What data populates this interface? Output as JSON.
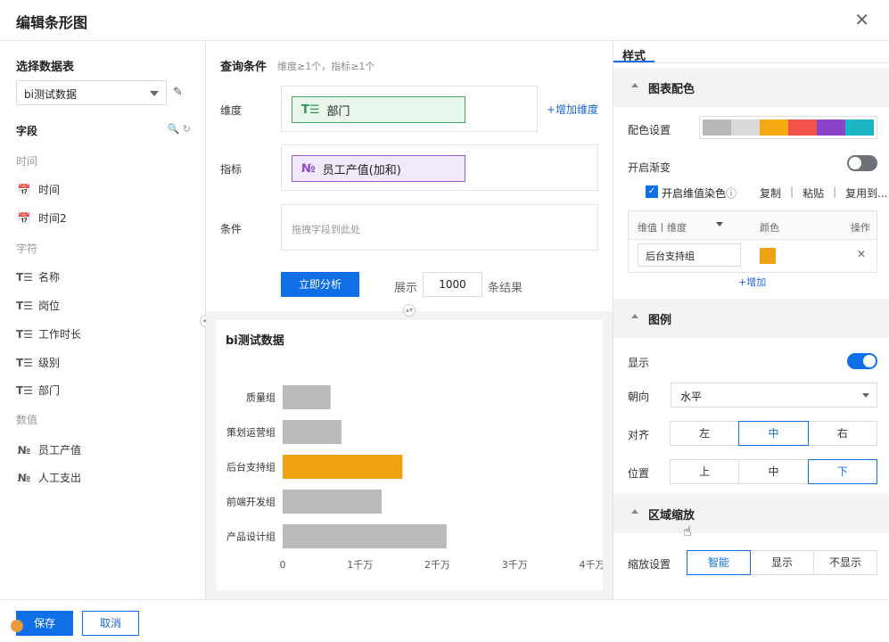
{
  "dialog": {
    "title": "编辑条形图",
    "close": "✕"
  },
  "left": {
    "section_title": "选择数据表",
    "table_select": "bi测试数据",
    "fields_label": "字段",
    "fields_icons": "🔍 ↻",
    "groups": [
      {
        "label": "时间",
        "fields": [
          {
            "icon": "📅",
            "name": "时间"
          },
          {
            "icon": "📅",
            "name": "时间2"
          }
        ]
      },
      {
        "label": "字符",
        "fields": [
          {
            "icon": "T☰",
            "name": "名称"
          },
          {
            "icon": "T☰",
            "name": "岗位"
          },
          {
            "icon": "T☰",
            "name": "工作时长"
          },
          {
            "icon": "T☰",
            "name": "级别"
          },
          {
            "icon": "T☰",
            "name": "部门"
          }
        ]
      },
      {
        "label": "数值",
        "fields": [
          {
            "icon": "№",
            "name": "员工产值"
          },
          {
            "icon": "№",
            "name": "人工支出"
          }
        ]
      }
    ]
  },
  "query": {
    "title": "查询条件",
    "hint": "维度≥1个，指标≥1个",
    "dimension_label": "维度",
    "dimension_chip": {
      "icon": "T☰",
      "text": "部门"
    },
    "add_dimension": "+增加维度",
    "metric_label": "指标",
    "metric_chip": {
      "icon": "№",
      "text": "员工产值(加和)"
    },
    "condition_label": "条件",
    "condition_placeholder": "拖拽字段到此处",
    "analyze_button": "立即分析",
    "show_label": "展示",
    "show_value": "1000",
    "show_suffix": "条结果"
  },
  "chart_data": {
    "type": "bar",
    "orientation": "horizontal",
    "title": "bi测试数据",
    "categories": [
      "质量组",
      "策划运营组",
      "后台支持组",
      "前端开发组",
      "产品设计组"
    ],
    "values": [
      6200000,
      7600000,
      15500000,
      12800000,
      21200000
    ],
    "highlight": "后台支持组",
    "bar_color": "#bbbbbb",
    "highlight_color": "#efa211",
    "xlim": [
      0,
      40000000
    ],
    "xticks": [
      "0",
      "1千万",
      "2千万",
      "3千万",
      "4千万"
    ],
    "grid": false
  },
  "style": {
    "tab": "样式",
    "sections": {
      "color": "图表配色",
      "legend": "图例",
      "zoom": "区域缩放"
    },
    "color_setting_label": "配色设置",
    "palette": [
      "#b8b8b8",
      "#d9d9d9",
      "#f5a915",
      "#f2544b",
      "#8c43c7",
      "#1bb6c4"
    ],
    "gradient_label": "开启渐变",
    "gradient_on": false,
    "dim_color_label": "开启维值染色",
    "dim_color_checked": true,
    "copy": "复制",
    "paste": "粘贴",
    "copy_to": "复用到...",
    "map_headers": {
      "dim": "维值丨维度",
      "color": "颜色",
      "op": "操作"
    },
    "map_row_value": "后台支持组",
    "map_row_color": "#efa211",
    "add_label": "+增加",
    "legend_show_label": "显示",
    "legend_show_on": true,
    "legend_orient_label": "朝向",
    "legend_orient_value": "水平",
    "legend_align_label": "对齐",
    "legend_align_options": [
      "左",
      "中",
      "右"
    ],
    "legend_align_selected": "中",
    "legend_pos_label": "位置",
    "legend_pos_options": [
      "上",
      "中",
      "下"
    ],
    "legend_pos_selected": "下",
    "zoom_label": "缩放设置",
    "zoom_options": [
      "智能",
      "显示",
      "不显示"
    ],
    "zoom_selected": "智能"
  },
  "footer": {
    "save": "保存",
    "cancel": "取消"
  },
  "colors": {
    "accent": "#0f6fe6",
    "dimension": "#2f9a52",
    "metric": "#8e44c8"
  }
}
